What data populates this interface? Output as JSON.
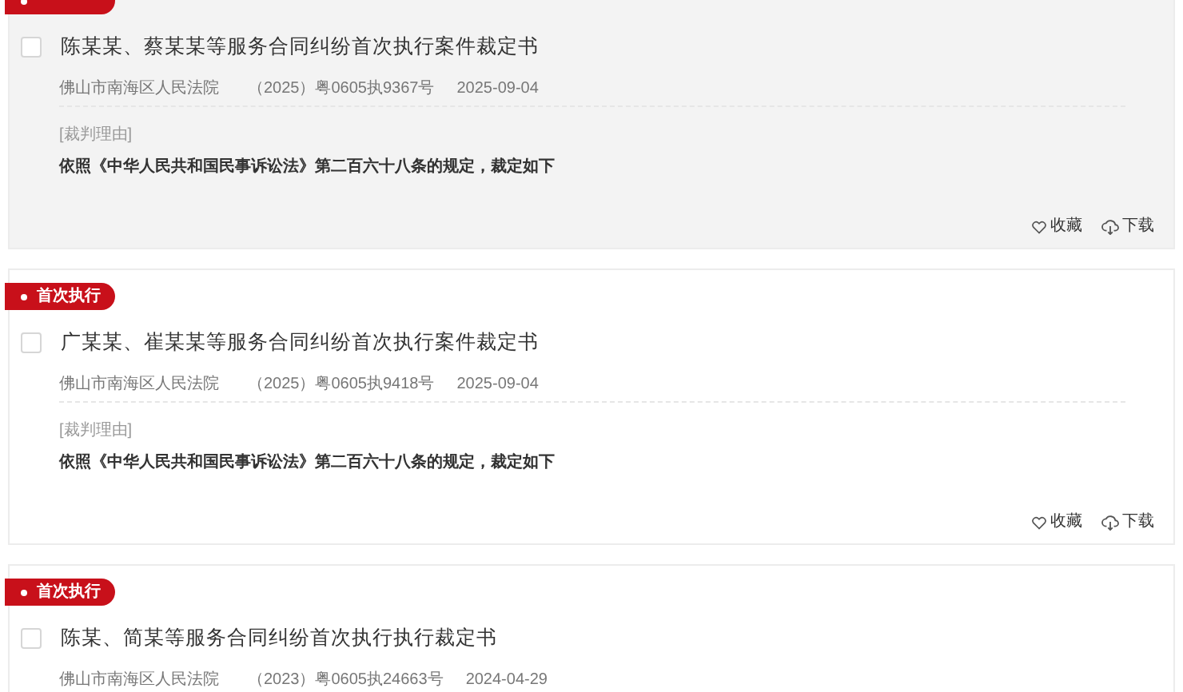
{
  "cards": [
    {
      "highlighted": true,
      "checked": false,
      "title": "陈某某、蔡某某等服务合同纠纷首次执行案件裁定书",
      "court": "佛山市南海区人民法院",
      "case_no": "（2025）粤0605执9367号",
      "date": "2025-09-04",
      "reason_label": "[裁判理由]",
      "reason": "依照《中华人民共和国民事诉讼法》第二百六十八条的规定，裁定如下",
      "actions": [
        "收藏",
        "下载"
      ]
    },
    {
      "tag": "首次执行",
      "highlighted": false,
      "checked": false,
      "title": "广某某、崔某某等服务合同纠纷首次执行案件裁定书",
      "court": "佛山市南海区人民法院",
      "case_no": "（2025）粤0605执9418号",
      "date": "2025-09-04",
      "reason_label": "[裁判理由]",
      "reason": "依照《中华人民共和国民事诉讼法》第二百六十八条的规定，裁定如下",
      "actions": [
        "收藏",
        "下载"
      ]
    },
    {
      "tag": "首次执行",
      "highlighted": false,
      "checked": false,
      "title": "陈某、简某等服务合同纠纷首次执行执行裁定书",
      "court": "佛山市南海区人民法院",
      "case_no": "（2023）粤0605执24663号",
      "date": "2024-04-29"
    }
  ]
}
